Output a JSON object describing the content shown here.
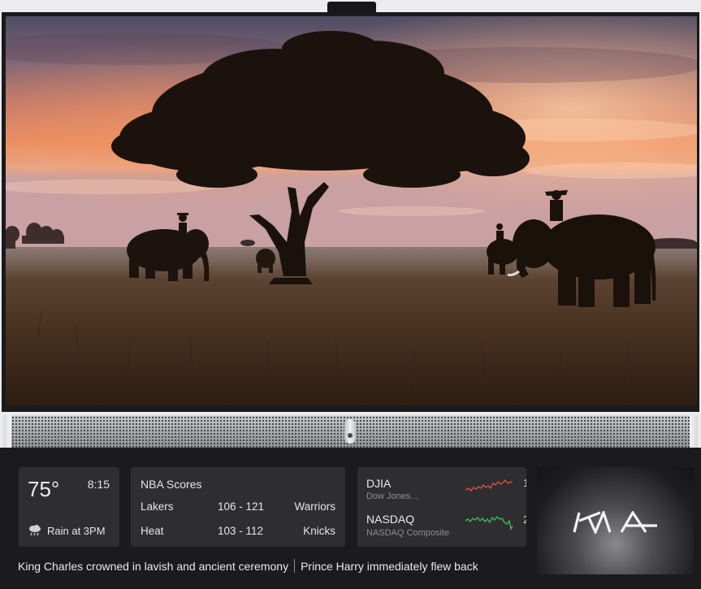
{
  "weather": {
    "temperature": "75°",
    "time": "8:15",
    "forecast": "Rain at 3PM",
    "icon": "rain-cloud-icon"
  },
  "nba": {
    "title": "NBA Scores",
    "games": [
      {
        "home": "Lakers",
        "score": "106 - 121",
        "away": "Warriors"
      },
      {
        "home": "Heat",
        "score": "103 - 112",
        "away": "Knicks"
      }
    ]
  },
  "stocks": [
    {
      "name": "DJIA",
      "subtitle": "Dow Jones...",
      "trend_color": "#e0533c",
      "edge": "1"
    },
    {
      "name": "NASDAQ",
      "subtitle": "NASDAQ Composite",
      "trend_color": "#3fbf5a",
      "edge": "2"
    }
  ],
  "ad": {
    "brand": "KIA",
    "logo_icon": "kia-logo-icon"
  },
  "news_ticker": {
    "items": [
      "King Charles crowned in lavish and ancient ceremony",
      "Prince Harry immediately flew back"
    ]
  },
  "screen": {
    "content": "sunset-elephants-landscape",
    "accent": "#e9845a"
  }
}
